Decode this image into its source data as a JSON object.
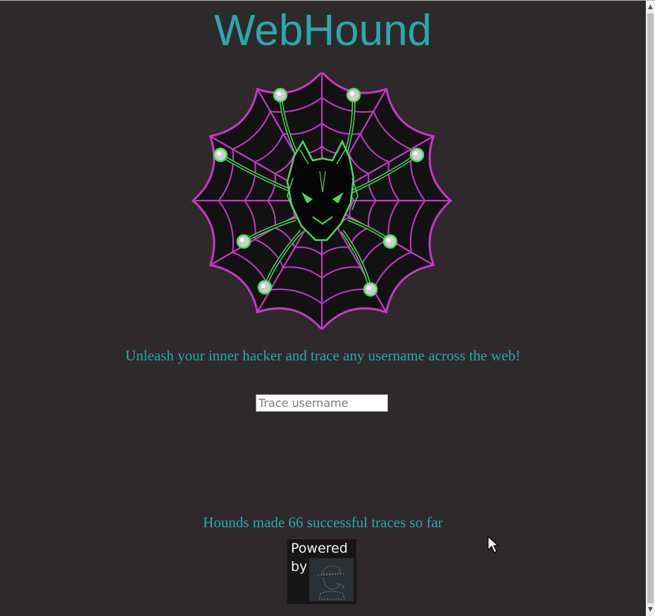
{
  "header": {
    "title": "WebHound"
  },
  "logo": {
    "name": "webhound-spider-wolf-logo",
    "colors": {
      "web": "#c837c8",
      "legs": "#4cd95a",
      "body": "#000000"
    }
  },
  "main": {
    "tagline": "Unleash your inner hacker and trace any username across the web!",
    "search": {
      "placeholder": "Trace username",
      "value": ""
    },
    "counter_text": "Hounds made 66 successful traces so far"
  },
  "footer": {
    "powered_line1": "Powered",
    "powered_line2": "by",
    "badge_icon": "detective-hat-icon"
  },
  "colors": {
    "background": "#2e2a2b",
    "accent": "#2aa8ad"
  }
}
